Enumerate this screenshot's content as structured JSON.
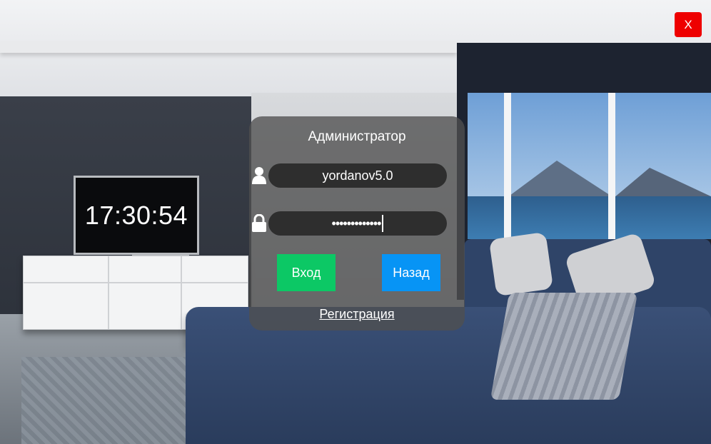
{
  "background": {
    "scene": "living-room"
  },
  "tv": {
    "clock": "17:30:54"
  },
  "window_controls": {
    "close_label": "X",
    "close_color": "#ee0000"
  },
  "login": {
    "title": "Администратор",
    "username": "yordanov5.0",
    "password_masked": "•••••••••••••",
    "user_icon": "user-icon",
    "lock_icon": "lock-icon",
    "login_label": "Вход",
    "login_color": "#0cc865",
    "back_label": "Назад",
    "back_color": "#0794f5",
    "register_label": "Регистрация"
  }
}
